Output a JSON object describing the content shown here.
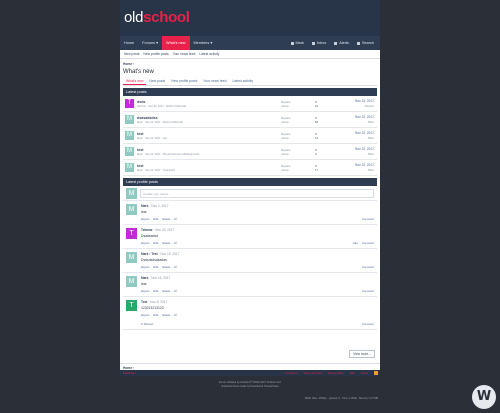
{
  "logo": {
    "part1": "old",
    "part2": "school"
  },
  "nav": {
    "items": [
      "Home",
      "Forums ▾",
      "What's new",
      "Members ▾"
    ],
    "right": [
      "Mark",
      "Inbox",
      "Alerts",
      "Search"
    ]
  },
  "subnav": [
    "New posts",
    "New profile posts",
    "Your news feed",
    "Latest activity"
  ],
  "crumb": "Home ›",
  "title": "What's new",
  "tabs": [
    "What's new",
    "New posts",
    "New profile posts",
    "Your news feed",
    "Latest activity"
  ],
  "threads_head": "Latest posts",
  "threads": [
    {
      "avatar": "T",
      "color": "#c22bd8",
      "title": "dsds",
      "meta": "Tekmaz · Nov 23, 2017 · World of Warcraft",
      "replies_label": "Replies:",
      "replies": "0",
      "views_label": "Views:",
      "views": "31",
      "date": "Nov 23, 2017",
      "user": "Tekmaz"
    },
    {
      "avatar": "M",
      "color": "#8fcac2",
      "title": "dsasadsdss",
      "meta": "Mark · Nov 22, 2017 · World of Warcraft",
      "replies_label": "Replies:",
      "replies": "0",
      "views_label": "Views:",
      "views": "18",
      "date": "Nov 22, 2017",
      "user": "Mark"
    },
    {
      "avatar": "M",
      "color": "#8fcac2",
      "title": "test",
      "meta": "Mark · Nov 22, 2017 · test",
      "replies_label": "Replies:",
      "replies": "0",
      "views_label": "Views:",
      "views": "14",
      "date": "Nov 22, 2017",
      "user": "Mark"
    },
    {
      "avatar": "M",
      "color": "#8fcac2",
      "title": "test",
      "meta": "Mark · Nov 22, 2017 · PlayerUnknown's Battlegrounds",
      "replies_label": "Replies:",
      "replies": "0",
      "views_label": "Views:",
      "views": "9",
      "date": "Nov 22, 2017",
      "user": "Mark"
    },
    {
      "avatar": "M",
      "color": "#8fcac2",
      "title": "test",
      "meta": "Mark · Nov 22, 2017 · Overwatch",
      "replies_label": "Replies:",
      "replies": "0",
      "views_label": "Views:",
      "views": "17",
      "date": "Nov 22, 2017",
      "user": "Mark"
    }
  ],
  "profile_head": "Latest profile posts",
  "post_placeholder": "Update your status...",
  "profile_posts": [
    {
      "avatar": "M",
      "color": "#8fcac2",
      "user": "Mark",
      "date": "· Dec 2, 2017",
      "text": "test",
      "like": "",
      "comment": "Comment"
    },
    {
      "avatar": "T",
      "color": "#c22bd8",
      "user": "Tekmaz",
      "date": "· Nov 23, 2017",
      "text": "Dsadsadsd",
      "like": "Like",
      "comment": "Comment"
    },
    {
      "avatar": "M",
      "color": "#8fcac2",
      "user": "Mark › Test",
      "date": "· Nov 15, 2017",
      "text": "Dsdsdsdsdsadas",
      "like": "",
      "comment": "Comment"
    },
    {
      "avatar": "M",
      "color": "#8fcac2",
      "user": "Mark",
      "date": "· Nov 15, 2017",
      "text": "test",
      "like": "",
      "comment": "Comment"
    },
    {
      "avatar": "T",
      "color": "#27a96a",
      "user": "Test",
      "date": "· Nov 8, 2017",
      "text": "123213213123",
      "like": "",
      "comment": "Comment"
    }
  ],
  "post_actions": [
    "Report",
    "Edit",
    "Delete",
    "IP"
  ],
  "likes_line": "♥ Tekmaz",
  "more_button": "View more...",
  "bottom_crumb": "Home ›",
  "footer_left": "oldschool ▾",
  "footer_right": [
    "Contact us",
    "Terms and rules",
    "Privacy policy",
    "Help",
    "Home"
  ],
  "copyright": [
    "Forum software by XenForo® ©2010-2017 XenForo Ltd.",
    "oldschool theme made by Pixel Exit & ThemeHouse"
  ],
  "stats": "Width: Max • 1500px · Queries: 8 · Time: 0.1309s · Memory: 6.77 MB",
  "watermark": "W"
}
